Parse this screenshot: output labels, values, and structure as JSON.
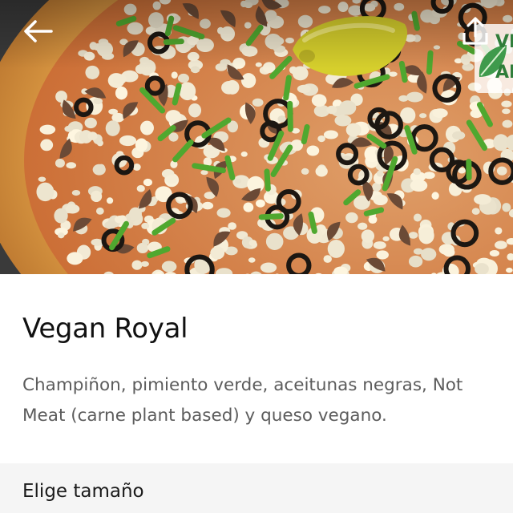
{
  "header": {
    "back_icon": "arrow-left-icon",
    "share_icon": "share-upload-icon"
  },
  "hero": {
    "image_description_icon": "pizza-photo",
    "badge_line1": "VE",
    "badge_line2": "AP",
    "badge_color": "#2f7d3a"
  },
  "product": {
    "title": "Vegan Royal",
    "description": "Champiñon, pimiento verde, aceitunas negras, Not Meat (carne plant based) y queso vegano."
  },
  "options": {
    "size_heading": "Elige tamaño"
  }
}
